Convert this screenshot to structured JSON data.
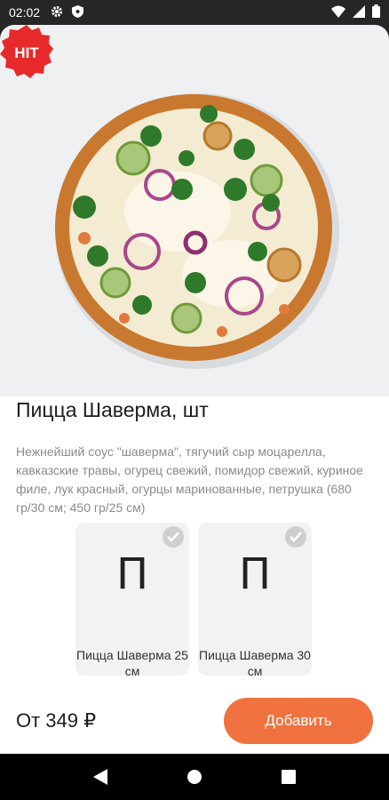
{
  "status_bar": {
    "time": "02:02",
    "left_icons": [
      "gear-icon",
      "shield-icon"
    ],
    "right_icons": [
      "wifi-icon",
      "signal-icon",
      "battery-icon"
    ]
  },
  "product": {
    "badge": "HIT",
    "title": "Пицца Шаверма, шт",
    "description": "Нежнейший соус  \"шаверма\", тягучий сыр моцарелла, кавказские травы, огурец свежий, помидор свежий, куриное филе, лук красный, огурцы маринованные, петрушка (680 гр/30 см; 450 гр/25 см)",
    "options": [
      {
        "glyph": "П",
        "label": "Пицца Шаверма 25 см",
        "selected_icon": "check-icon"
      },
      {
        "glyph": "П",
        "label": "Пицца Шаверма 30 см",
        "selected_icon": "check-icon"
      }
    ]
  },
  "footer": {
    "price": "От 349 ₽",
    "add_label": "Добавить"
  },
  "colors": {
    "accent": "#f0733f",
    "badge": "#e8292b"
  },
  "nav": [
    "back-icon",
    "home-icon",
    "recents-icon"
  ]
}
